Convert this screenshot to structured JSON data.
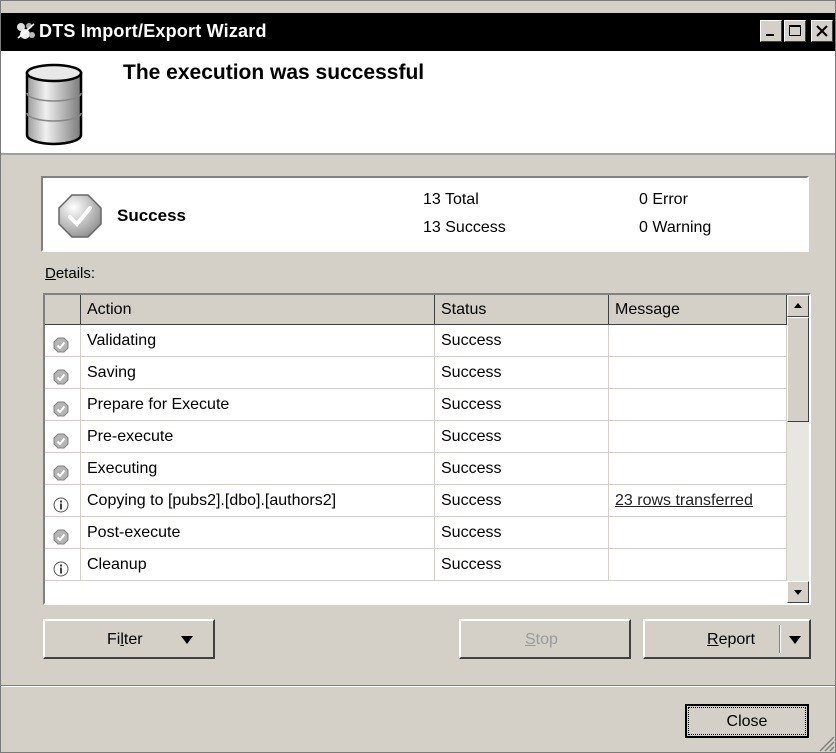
{
  "window": {
    "title": "DTS Import/Export Wizard"
  },
  "header": {
    "heading": "The execution was successful"
  },
  "summary": {
    "status": "Success",
    "total": "13 Total",
    "success": "13 Success",
    "error": "0 Error",
    "warning": "0 Warning"
  },
  "details_label_accel": "D",
  "details_label_rest": "etails:",
  "grid": {
    "columns": [
      "Action",
      "Status",
      "Message"
    ],
    "rows": [
      {
        "icon": "success-icon",
        "action": "Validating",
        "status": "Success",
        "message": ""
      },
      {
        "icon": "success-icon",
        "action": "Saving",
        "status": "Success",
        "message": ""
      },
      {
        "icon": "success-icon",
        "action": "Prepare for Execute",
        "status": "Success",
        "message": ""
      },
      {
        "icon": "success-icon",
        "action": "Pre-execute",
        "status": "Success",
        "message": ""
      },
      {
        "icon": "success-icon",
        "action": "Executing",
        "status": "Success",
        "message": ""
      },
      {
        "icon": "info-icon",
        "action": "Copying to [pubs2].[dbo].[authors2]",
        "status": "Success",
        "message": "23 rows transferred"
      },
      {
        "icon": "success-icon",
        "action": "Post-execute",
        "status": "Success",
        "message": ""
      },
      {
        "icon": "info-icon",
        "action": "Cleanup",
        "status": "Success",
        "message": ""
      }
    ]
  },
  "buttons": {
    "filter_pre": "Fi",
    "filter_accel": "l",
    "filter_post": "ter",
    "stop_accel": "S",
    "stop_rest": "top",
    "report_accel": "R",
    "report_rest": "eport",
    "close": "Close"
  },
  "colors": {
    "titlebar": "#000000",
    "face": "#d4d0c8",
    "disabled_text": "#9a9a9a"
  }
}
